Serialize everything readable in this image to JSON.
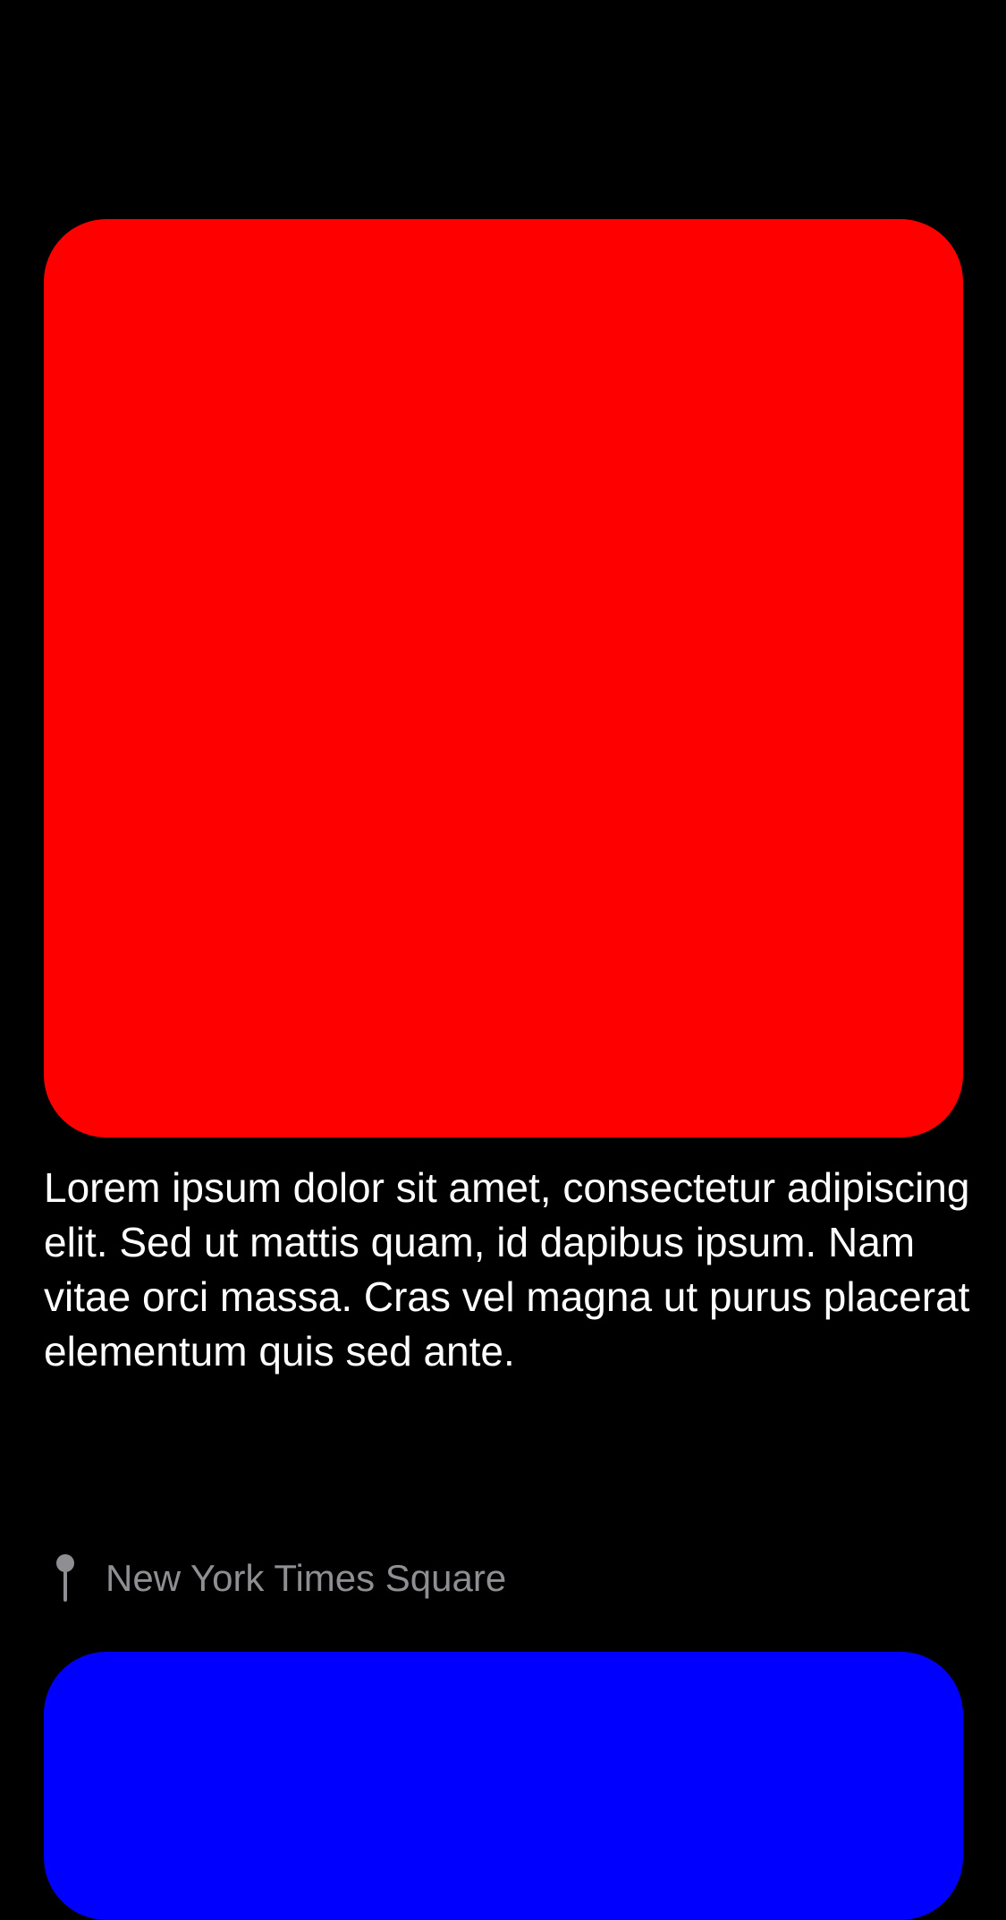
{
  "colors": {
    "background": "#000000",
    "first_card": "#FF0000",
    "second_card": "#0000FF",
    "body_text": "#FFFFFF",
    "secondary_text": "#8E8E93"
  },
  "post": {
    "body": "Lorem ipsum dolor sit amet, consectetur adipiscing elit. Sed ut mattis quam, id dapibus ipsum. Nam vitae orci massa. Cras vel magna ut purus placerat elementum quis sed ante.",
    "location": {
      "icon": "map-pin-icon",
      "label": "New York Times Square"
    }
  }
}
